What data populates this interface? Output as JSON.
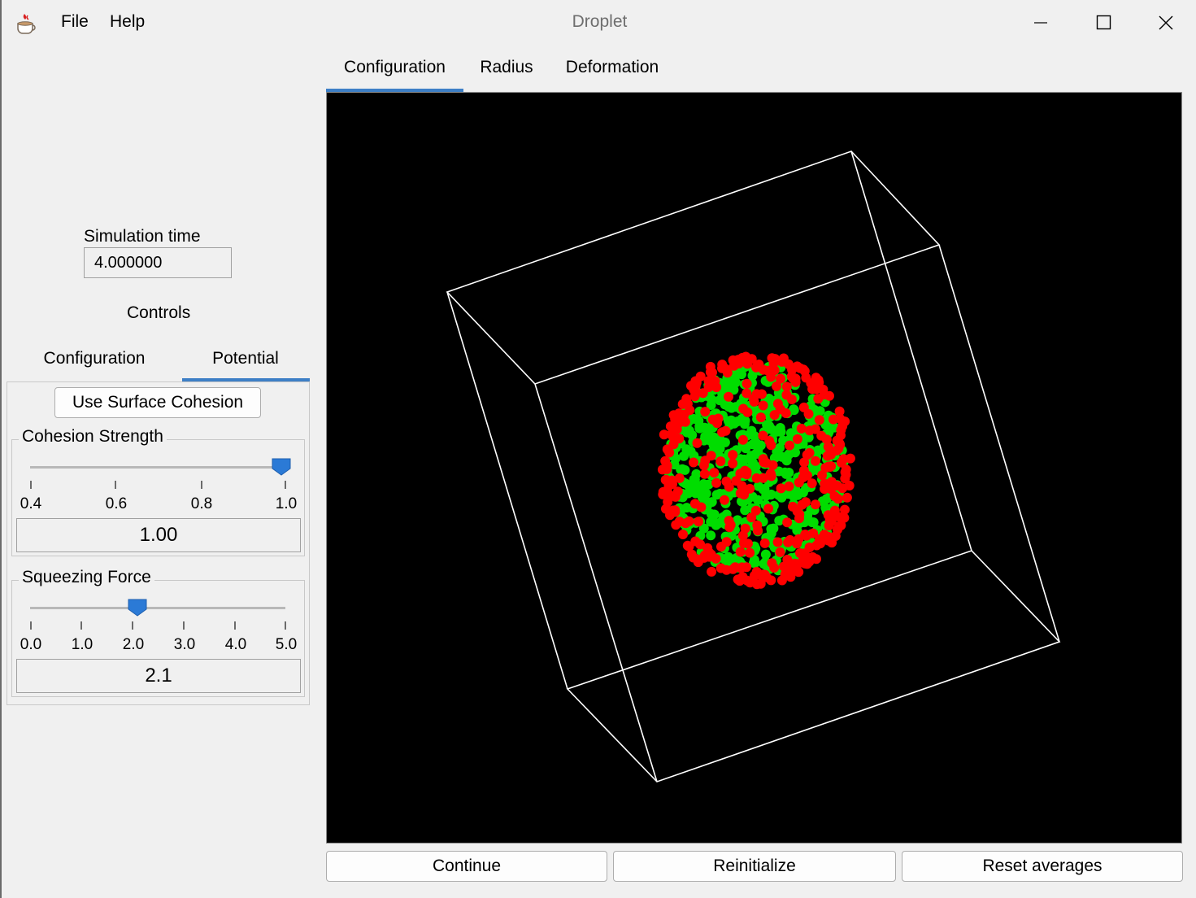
{
  "window": {
    "title": "Droplet"
  },
  "menu": {
    "file": "File",
    "help": "Help"
  },
  "left_panel": {
    "simulation_time_label": "Simulation time",
    "simulation_time_value": "4.000000",
    "controls_label": "Controls",
    "tabs": [
      {
        "label": "Configuration"
      },
      {
        "label": "Potential",
        "selected": true
      }
    ],
    "use_surface_cohesion_label": "Use Surface Cohesion",
    "cohesion": {
      "label": "Cohesion Strength",
      "ticks": [
        "0.4",
        "0.6",
        "0.8",
        "1.0"
      ],
      "value": "1.00",
      "level": 1.0
    },
    "squeezing": {
      "label": "Squeezing Force",
      "ticks": [
        "0.0",
        "1.0",
        "2.0",
        "3.0",
        "4.0",
        "5.0"
      ],
      "value": "2.1",
      "level": 0.42
    }
  },
  "main": {
    "tabs": [
      {
        "label": "Configuration",
        "selected": true
      },
      {
        "label": "Radius"
      },
      {
        "label": "Deformation"
      }
    ]
  },
  "buttons": {
    "continue": "Continue",
    "reinitialize": "Reinitialize",
    "reset_averages": "Reset averages"
  },
  "colors": {
    "accent": "#3d7fc6",
    "particle_surface": "#ff0000",
    "particle_bulk": "#00dd00",
    "box_edges": "#ffffff"
  }
}
